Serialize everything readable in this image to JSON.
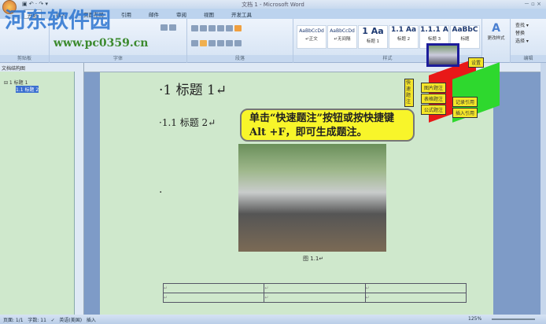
{
  "window": {
    "title": "文档 1 - Microsoft Word",
    "controls": "－ ▫ ×"
  },
  "qat": "▣ ↶ · ↷ ▾",
  "tabs": [
    "开始",
    "插入",
    "页面布局",
    "引用",
    "邮件",
    "审阅",
    "视图",
    "开发工具"
  ],
  "ribbon": {
    "groups": [
      "剪贴板",
      "字体",
      "段落",
      "样式",
      "编辑"
    ],
    "styles": [
      {
        "preview": "AaBbCcDd",
        "name": "↵正文"
      },
      {
        "preview": "AaBbCcDd",
        "name": "↵无间隔"
      },
      {
        "preview": "1 Aa",
        "name": "标题 1"
      },
      {
        "preview": "1.1 Aa",
        "name": "标题 2"
      },
      {
        "preview": "1.1.1 A",
        "name": "标题 3"
      },
      {
        "preview": "AaBbC",
        "name": "标题"
      }
    ],
    "change_styles": "更改样式",
    "edit": [
      "查找 ▾",
      "替换",
      "选择 ▾"
    ]
  },
  "watermark": {
    "name": "河东软件园",
    "url": "www.pc0359.cn"
  },
  "navpane": {
    "title": "文档结构图",
    "items": [
      "⊟ 1 标题 1",
      "1.1 标题 2"
    ]
  },
  "document": {
    "heading1": "·1 标题 1↵",
    "heading2": "·1.1 标题 2↵",
    "bullet": "·",
    "caption": "图 1.1↵",
    "callout": "单击“快速题注”按钮或按快捷键 Alt +F，即可生成题注。",
    "table_cells": [
      [
        "↵",
        "↵",
        "↵"
      ],
      [
        "↵",
        "↵",
        "↵"
      ]
    ]
  },
  "overlay": {
    "quick": "快速题注",
    "settings": "设置",
    "red": [
      "图片题注",
      "表格题注",
      "公式题注"
    ],
    "green": [
      "记录引用",
      "插入引用"
    ]
  },
  "status": {
    "page": "页面: 1/1",
    "words": "字数: 11",
    "lang": "英语(美国)",
    "mode": "插入",
    "zoom": "125%"
  }
}
